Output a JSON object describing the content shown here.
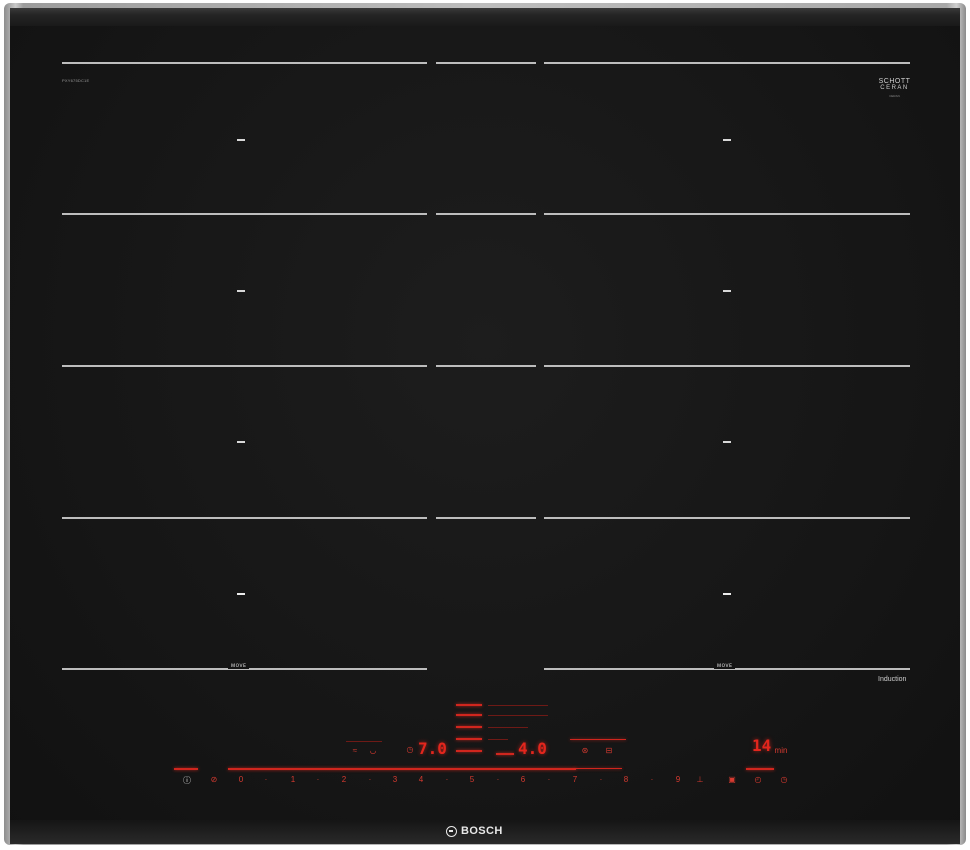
{
  "hob": {
    "model_code": "PXY675DC1E",
    "glass_brand_line1": "SCHOTT",
    "glass_brand_line2": "CERAN",
    "glass_brand_line3": "CERAN",
    "move_label_left": "ᴍᴏᴠᴇ",
    "move_label_right": "ᴍᴏᴠᴇ",
    "induction_label": "Induction",
    "brand_name": "BOSCH"
  },
  "control_panel": {
    "left_display": "7.0",
    "center_display": "4.0",
    "timer_display": "14",
    "timer_unit": "min",
    "power_scale": [
      "0",
      "1",
      "2",
      "3",
      "4",
      "5",
      "6",
      "7",
      "8",
      "9"
    ],
    "icons": {
      "power": "power-icon",
      "lock": "child-lock-icon",
      "boost": "boost-icon",
      "frying": "frying-sensor-icon",
      "timer": "timer-icon",
      "clock": "clock-icon",
      "pan": "pan-icon"
    }
  },
  "colors": {
    "glass": "#161616",
    "display_red": "#e3261d",
    "zone_marking": "#bdbdbd"
  }
}
